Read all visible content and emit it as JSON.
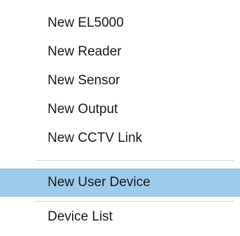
{
  "context_menu": {
    "items": [
      {
        "label": "New EL5000"
      },
      {
        "label": "New Reader"
      },
      {
        "label": "New Sensor"
      },
      {
        "label": "New Output"
      },
      {
        "label": "New CCTV Link"
      },
      {
        "label": "New User Device",
        "highlighted": true
      },
      {
        "label": "Device List"
      }
    ],
    "highlight_color": "#9ecbec"
  }
}
